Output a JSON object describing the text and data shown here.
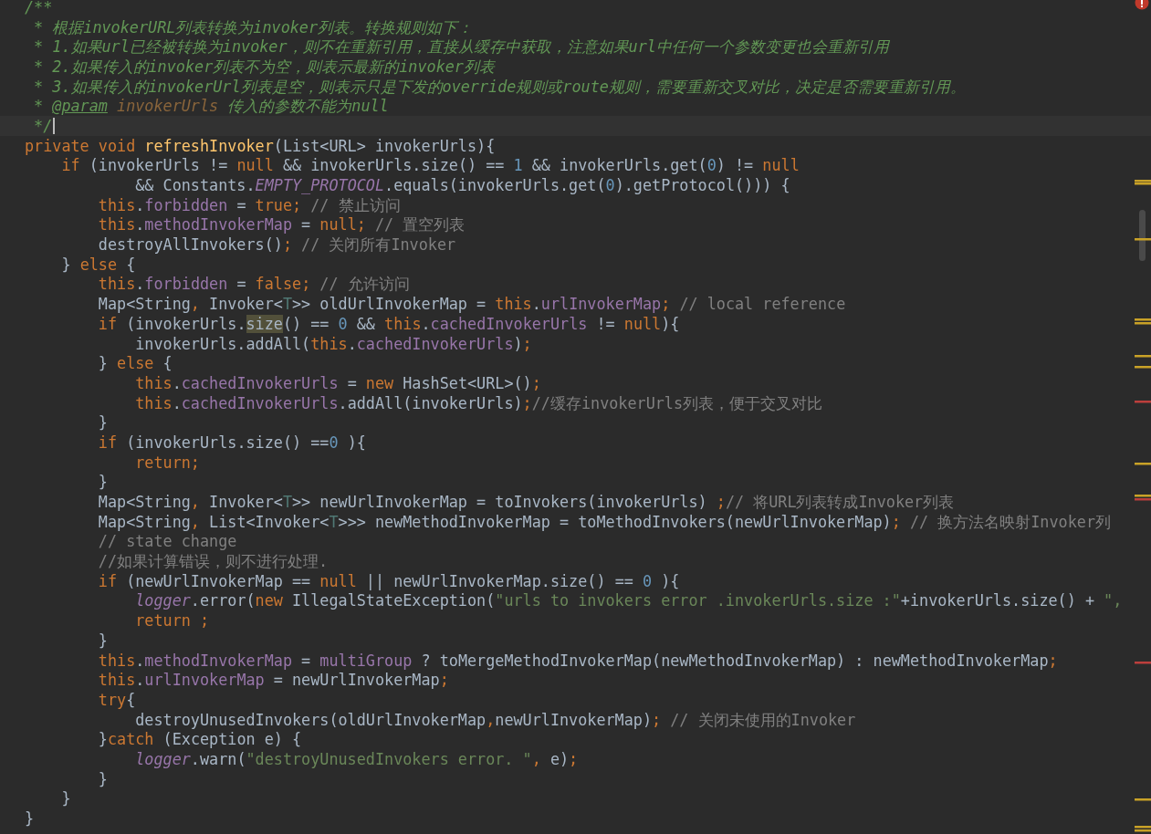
{
  "editor": {
    "lines": [
      {
        "current": false,
        "tokens": [
          {
            "kind": "doc",
            "text": "/**"
          }
        ]
      },
      {
        "current": false,
        "tokens": [
          {
            "kind": "doc",
            "text": " * 根据invokerURL列表转换为invoker列表。转换规则如下："
          }
        ]
      },
      {
        "current": false,
        "tokens": [
          {
            "kind": "doc",
            "text": " * 1.如果url已经被转换为invoker，则不在重新引用，直接从缓存中获取，注意如果url中任何一个参数变更也会重新引用"
          }
        ]
      },
      {
        "current": false,
        "tokens": [
          {
            "kind": "doc",
            "text": " * 2.如果传入的invoker列表不为空，则表示最新的invoker列表"
          }
        ]
      },
      {
        "current": false,
        "tokens": [
          {
            "kind": "doc",
            "text": " * 3.如果传入的invokerUrl列表是空，则表示只是下发的override规则或route规则，需要重新交叉对比，决定是否需要重新引用。"
          }
        ]
      },
      {
        "current": false,
        "tokens": [
          {
            "kind": "doc",
            "text": " * "
          },
          {
            "kind": "doctag",
            "text": "@param"
          },
          {
            "kind": "docparam",
            "text": " invokerUrls"
          },
          {
            "kind": "doc",
            "text": " 传入的参数不能为null"
          }
        ]
      },
      {
        "current": true,
        "tokens": [
          {
            "kind": "doc",
            "text": " */"
          }
        ]
      },
      {
        "current": false,
        "tokens": [
          {
            "kind": "kw",
            "text": "private void "
          },
          {
            "kind": "fn",
            "text": "refreshInvoker"
          },
          {
            "kind": "plain",
            "text": "(List<URL> invokerUrls){"
          }
        ]
      },
      {
        "current": false,
        "tokens": [
          {
            "kind": "kw",
            "text": "    if"
          },
          {
            "kind": "plain",
            "text": " (invokerUrls != "
          },
          {
            "kind": "kw",
            "text": "null"
          },
          {
            "kind": "plain",
            "text": " && invokerUrls.size() == "
          },
          {
            "kind": "num",
            "text": "1"
          },
          {
            "kind": "plain",
            "text": " && invokerUrls.get("
          },
          {
            "kind": "num",
            "text": "0"
          },
          {
            "kind": "plain",
            "text": ") != "
          },
          {
            "kind": "kw",
            "text": "null"
          }
        ]
      },
      {
        "current": false,
        "tokens": [
          {
            "kind": "plain",
            "text": "            && Constants."
          },
          {
            "kind": "static",
            "text": "EMPTY_PROTOCOL"
          },
          {
            "kind": "plain",
            "text": ".equals(invokerUrls.get("
          },
          {
            "kind": "num",
            "text": "0"
          },
          {
            "kind": "plain",
            "text": ").getProtocol())) {"
          }
        ]
      },
      {
        "current": false,
        "tokens": [
          {
            "kind": "kw",
            "text": "        this"
          },
          {
            "kind": "plain",
            "text": "."
          },
          {
            "kind": "field",
            "text": "forbidden"
          },
          {
            "kind": "plain",
            "text": " = "
          },
          {
            "kind": "kw",
            "text": "true;"
          },
          {
            "kind": "comment",
            "text": " // 禁止访问"
          }
        ]
      },
      {
        "current": false,
        "tokens": [
          {
            "kind": "kw",
            "text": "        this"
          },
          {
            "kind": "plain",
            "text": "."
          },
          {
            "kind": "field",
            "text": "methodInvokerMap"
          },
          {
            "kind": "plain",
            "text": " = "
          },
          {
            "kind": "kw",
            "text": "null;"
          },
          {
            "kind": "comment",
            "text": " // 置空列表"
          }
        ]
      },
      {
        "current": false,
        "tokens": [
          {
            "kind": "plain",
            "text": "        destroyAllInvokers()"
          },
          {
            "kind": "kw",
            "text": ";"
          },
          {
            "kind": "comment",
            "text": " // 关闭所有Invoker"
          }
        ]
      },
      {
        "current": false,
        "tokens": [
          {
            "kind": "plain",
            "text": "    } "
          },
          {
            "kind": "kw",
            "text": "else"
          },
          {
            "kind": "plain",
            "text": " {"
          }
        ]
      },
      {
        "current": false,
        "tokens": [
          {
            "kind": "kw",
            "text": "        this"
          },
          {
            "kind": "plain",
            "text": "."
          },
          {
            "kind": "field",
            "text": "forbidden"
          },
          {
            "kind": "plain",
            "text": " = "
          },
          {
            "kind": "kw",
            "text": "false;"
          },
          {
            "kind": "comment",
            "text": " // 允许访问"
          }
        ]
      },
      {
        "current": false,
        "tokens": [
          {
            "kind": "plain",
            "text": "        Map<String"
          },
          {
            "kind": "kw",
            "text": ","
          },
          {
            "kind": "plain",
            "text": " Invoker<"
          },
          {
            "kind": "tparam",
            "text": "T"
          },
          {
            "kind": "plain",
            "text": ">> oldUrlInvokerMap = "
          },
          {
            "kind": "kw",
            "text": "this"
          },
          {
            "kind": "plain",
            "text": "."
          },
          {
            "kind": "field",
            "text": "urlInvokerMap"
          },
          {
            "kind": "kw",
            "text": ";"
          },
          {
            "kind": "comment",
            "text": " // local reference"
          }
        ]
      },
      {
        "current": false,
        "tokens": [
          {
            "kind": "kw",
            "text": "        if"
          },
          {
            "kind": "plain",
            "text": " (invokerUrls."
          },
          {
            "kind": "hl",
            "text": "size"
          },
          {
            "kind": "plain",
            "text": "() == "
          },
          {
            "kind": "num",
            "text": "0"
          },
          {
            "kind": "plain",
            "text": " && "
          },
          {
            "kind": "kw",
            "text": "this"
          },
          {
            "kind": "plain",
            "text": "."
          },
          {
            "kind": "field",
            "text": "cachedInvokerUrls"
          },
          {
            "kind": "plain",
            "text": " != "
          },
          {
            "kind": "kw",
            "text": "null"
          },
          {
            "kind": "plain",
            "text": "){"
          }
        ]
      },
      {
        "current": false,
        "tokens": [
          {
            "kind": "plain",
            "text": "            invokerUrls.addAll("
          },
          {
            "kind": "kw",
            "text": "this"
          },
          {
            "kind": "plain",
            "text": "."
          },
          {
            "kind": "field",
            "text": "cachedInvokerUrls"
          },
          {
            "kind": "plain",
            "text": ")"
          },
          {
            "kind": "kw",
            "text": ";"
          }
        ]
      },
      {
        "current": false,
        "tokens": [
          {
            "kind": "plain",
            "text": "        } "
          },
          {
            "kind": "kw",
            "text": "else"
          },
          {
            "kind": "plain",
            "text": " {"
          }
        ]
      },
      {
        "current": false,
        "tokens": [
          {
            "kind": "kw",
            "text": "            this"
          },
          {
            "kind": "plain",
            "text": "."
          },
          {
            "kind": "field",
            "text": "cachedInvokerUrls"
          },
          {
            "kind": "plain",
            "text": " = "
          },
          {
            "kind": "kw",
            "text": "new"
          },
          {
            "kind": "plain",
            "text": " HashSet<URL>()"
          },
          {
            "kind": "kw",
            "text": ";"
          }
        ]
      },
      {
        "current": false,
        "tokens": [
          {
            "kind": "kw",
            "text": "            this"
          },
          {
            "kind": "plain",
            "text": "."
          },
          {
            "kind": "field",
            "text": "cachedInvokerUrls"
          },
          {
            "kind": "plain",
            "text": ".addAll(invokerUrls)"
          },
          {
            "kind": "kw",
            "text": ";"
          },
          {
            "kind": "comment",
            "text": "//缓存invokerUrls列表，便于交叉对比"
          }
        ]
      },
      {
        "current": false,
        "tokens": [
          {
            "kind": "plain",
            "text": "        }"
          }
        ]
      },
      {
        "current": false,
        "tokens": [
          {
            "kind": "kw",
            "text": "        if"
          },
          {
            "kind": "plain",
            "text": " (invokerUrls.size() =="
          },
          {
            "kind": "num",
            "text": "0"
          },
          {
            "kind": "plain",
            "text": " ){"
          }
        ]
      },
      {
        "current": false,
        "tokens": [
          {
            "kind": "kw",
            "text": "            return;"
          }
        ]
      },
      {
        "current": false,
        "tokens": [
          {
            "kind": "plain",
            "text": "        }"
          }
        ]
      },
      {
        "current": false,
        "tokens": [
          {
            "kind": "plain",
            "text": "        Map<String"
          },
          {
            "kind": "kw",
            "text": ","
          },
          {
            "kind": "plain",
            "text": " Invoker<"
          },
          {
            "kind": "tparam",
            "text": "T"
          },
          {
            "kind": "plain",
            "text": ">> newUrlInvokerMap = toInvokers(invokerUrls) "
          },
          {
            "kind": "kw",
            "text": ";"
          },
          {
            "kind": "comment",
            "text": "// 将URL列表转成Invoker列表"
          }
        ]
      },
      {
        "current": false,
        "tokens": [
          {
            "kind": "plain",
            "text": "        Map<String"
          },
          {
            "kind": "kw",
            "text": ","
          },
          {
            "kind": "plain",
            "text": " List<Invoker<"
          },
          {
            "kind": "tparam",
            "text": "T"
          },
          {
            "kind": "plain",
            "text": ">>> newMethodInvokerMap = toMethodInvokers(newUrlInvokerMap)"
          },
          {
            "kind": "kw",
            "text": ";"
          },
          {
            "kind": "comment",
            "text": " // 换方法名映射Invoker列"
          }
        ]
      },
      {
        "current": false,
        "tokens": [
          {
            "kind": "comment",
            "text": "        // state change"
          }
        ]
      },
      {
        "current": false,
        "tokens": [
          {
            "kind": "comment",
            "text": "        //如果计算错误，则不进行处理."
          }
        ]
      },
      {
        "current": false,
        "tokens": [
          {
            "kind": "kw",
            "text": "        if"
          },
          {
            "kind": "plain",
            "text": " (newUrlInvokerMap == "
          },
          {
            "kind": "kw",
            "text": "null"
          },
          {
            "kind": "plain",
            "text": " || newUrlInvokerMap.size() == "
          },
          {
            "kind": "num",
            "text": "0"
          },
          {
            "kind": "plain",
            "text": " ){"
          }
        ]
      },
      {
        "current": false,
        "tokens": [
          {
            "kind": "static",
            "text": "            logger"
          },
          {
            "kind": "plain",
            "text": ".error("
          },
          {
            "kind": "kw",
            "text": "new"
          },
          {
            "kind": "plain",
            "text": " IllegalStateException("
          },
          {
            "kind": "str",
            "text": "\"urls to invokers error .invokerUrls.size :\""
          },
          {
            "kind": "plain",
            "text": "+invokerUrls.size() + "
          },
          {
            "kind": "str",
            "text": "\","
          }
        ]
      },
      {
        "current": false,
        "tokens": [
          {
            "kind": "kw",
            "text": "            return ;"
          }
        ]
      },
      {
        "current": false,
        "tokens": [
          {
            "kind": "plain",
            "text": "        }"
          }
        ]
      },
      {
        "current": false,
        "tokens": [
          {
            "kind": "kw",
            "text": "        this"
          },
          {
            "kind": "plain",
            "text": "."
          },
          {
            "kind": "field",
            "text": "methodInvokerMap"
          },
          {
            "kind": "plain",
            "text": " = "
          },
          {
            "kind": "field",
            "text": "multiGroup"
          },
          {
            "kind": "plain",
            "text": " ? toMergeMethodInvokerMap(newMethodInvokerMap) : newMethodInvokerMap"
          },
          {
            "kind": "kw",
            "text": ";"
          }
        ]
      },
      {
        "current": false,
        "tokens": [
          {
            "kind": "kw",
            "text": "        this"
          },
          {
            "kind": "plain",
            "text": "."
          },
          {
            "kind": "field",
            "text": "urlInvokerMap"
          },
          {
            "kind": "plain",
            "text": " = newUrlInvokerMap"
          },
          {
            "kind": "kw",
            "text": ";"
          }
        ]
      },
      {
        "current": false,
        "tokens": [
          {
            "kind": "kw",
            "text": "        try"
          },
          {
            "kind": "plain",
            "text": "{"
          }
        ]
      },
      {
        "current": false,
        "tokens": [
          {
            "kind": "plain",
            "text": "            destroyUnusedInvokers(oldUrlInvokerMap"
          },
          {
            "kind": "kw",
            "text": ","
          },
          {
            "kind": "plain",
            "text": "newUrlInvokerMap)"
          },
          {
            "kind": "kw",
            "text": ";"
          },
          {
            "kind": "comment",
            "text": " // 关闭未使用的Invoker"
          }
        ]
      },
      {
        "current": false,
        "tokens": [
          {
            "kind": "plain",
            "text": "        }"
          },
          {
            "kind": "kw",
            "text": "catch"
          },
          {
            "kind": "plain",
            "text": " (Exception e) {"
          }
        ]
      },
      {
        "current": false,
        "tokens": [
          {
            "kind": "static",
            "text": "            logger"
          },
          {
            "kind": "plain",
            "text": ".warn("
          },
          {
            "kind": "str",
            "text": "\"destroyUnusedInvokers error. \""
          },
          {
            "kind": "kw",
            "text": ","
          },
          {
            "kind": "plain",
            "text": " e)"
          },
          {
            "kind": "kw",
            "text": ";"
          }
        ]
      },
      {
        "current": false,
        "tokens": [
          {
            "kind": "plain",
            "text": "        }"
          }
        ]
      },
      {
        "current": false,
        "tokens": [
          {
            "kind": "plain",
            "text": "    }"
          }
        ]
      },
      {
        "current": false,
        "tokens": [
          {
            "kind": "plain",
            "text": "}"
          }
        ]
      }
    ]
  }
}
